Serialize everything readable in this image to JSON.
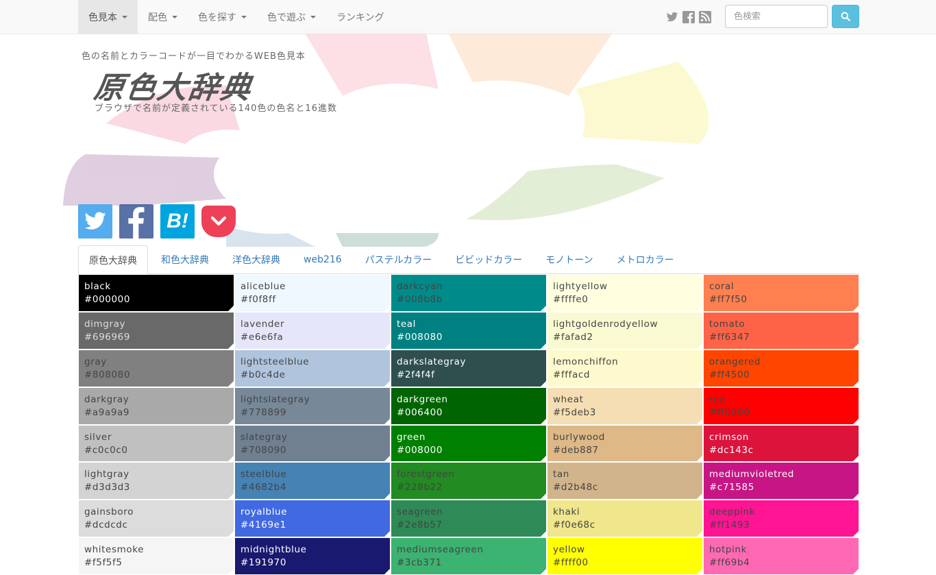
{
  "nav": {
    "items": [
      {
        "label": "色見本",
        "caret": true,
        "active": true
      },
      {
        "label": "配色",
        "caret": true
      },
      {
        "label": "色を探す",
        "caret": true
      },
      {
        "label": "色で遊ぶ",
        "caret": true
      },
      {
        "label": "ランキング",
        "caret": false
      }
    ],
    "social": [
      "twitter-icon",
      "facebook-icon",
      "rss-icon"
    ],
    "search_placeholder": "色検索"
  },
  "header": {
    "tagline": "色の名前とカラーコードが一目でわかるWEB色見本",
    "logo": "原色大辞典",
    "subtitle": "ブラウザで名前が定義されている140色の色名と16進数"
  },
  "share": [
    "twitter-share",
    "facebook-share",
    "hatena-bookmark-share",
    "pocket-share"
  ],
  "tabs": [
    {
      "label": "原色大辞典",
      "active": true
    },
    {
      "label": "和色大辞典"
    },
    {
      "label": "洋色大辞典"
    },
    {
      "label": "web216"
    },
    {
      "label": "パステルカラー"
    },
    {
      "label": "ビビッドカラー"
    },
    {
      "label": "モノトーン"
    },
    {
      "label": "メトロカラー"
    }
  ],
  "colors": [
    [
      {
        "name": "black",
        "hex": "#000000"
      },
      {
        "name": "dimgray",
        "hex": "#696969"
      },
      {
        "name": "gray",
        "hex": "#808080"
      },
      {
        "name": "darkgray",
        "hex": "#a9a9a9"
      },
      {
        "name": "silver",
        "hex": "#c0c0c0"
      },
      {
        "name": "lightgray",
        "hex": "#d3d3d3"
      },
      {
        "name": "gainsboro",
        "hex": "#dcdcdc"
      },
      {
        "name": "whitesmoke",
        "hex": "#f5f5f5"
      }
    ],
    [
      {
        "name": "aliceblue",
        "hex": "#f0f8ff"
      },
      {
        "name": "lavender",
        "hex": "#e6e6fa"
      },
      {
        "name": "lightsteelblue",
        "hex": "#b0c4de"
      },
      {
        "name": "lightslategray",
        "hex": "#778899"
      },
      {
        "name": "slategray",
        "hex": "#708090"
      },
      {
        "name": "steelblue",
        "hex": "#4682b4"
      },
      {
        "name": "royalblue",
        "hex": "#4169e1"
      },
      {
        "name": "midnightblue",
        "hex": "#191970"
      }
    ],
    [
      {
        "name": "darkcyan",
        "hex": "#008b8b"
      },
      {
        "name": "teal",
        "hex": "#008080"
      },
      {
        "name": "darkslategray",
        "hex": "#2f4f4f"
      },
      {
        "name": "darkgreen",
        "hex": "#006400"
      },
      {
        "name": "green",
        "hex": "#008000"
      },
      {
        "name": "forestgreen",
        "hex": "#228b22"
      },
      {
        "name": "seagreen",
        "hex": "#2e8b57"
      },
      {
        "name": "mediumseagreen",
        "hex": "#3cb371"
      }
    ],
    [
      {
        "name": "lightyellow",
        "hex": "#ffffe0"
      },
      {
        "name": "lightgoldenrodyellow",
        "hex": "#fafad2"
      },
      {
        "name": "lemonchiffon",
        "hex": "#fffacd"
      },
      {
        "name": "wheat",
        "hex": "#f5deb3"
      },
      {
        "name": "burlywood",
        "hex": "#deb887"
      },
      {
        "name": "tan",
        "hex": "#d2b48c"
      },
      {
        "name": "khaki",
        "hex": "#f0e68c"
      },
      {
        "name": "yellow",
        "hex": "#ffff00"
      }
    ],
    [
      {
        "name": "coral",
        "hex": "#ff7f50"
      },
      {
        "name": "tomato",
        "hex": "#ff6347"
      },
      {
        "name": "orangered",
        "hex": "#ff4500"
      },
      {
        "name": "red",
        "hex": "#ff0000"
      },
      {
        "name": "crimson",
        "hex": "#dc143c"
      },
      {
        "name": "mediumvioletred",
        "hex": "#c71585"
      },
      {
        "name": "deeppink",
        "hex": "#ff1493"
      },
      {
        "name": "hotpink",
        "hex": "#ff69b4"
      }
    ]
  ],
  "text_colors": [
    [
      "#ffffff",
      "#dddddd",
      "#444444",
      "#444444",
      "#444444",
      "#444444",
      "#444444",
      "#444444"
    ],
    [
      "#444444",
      "#444444",
      "#444444",
      "#444444",
      "#444444",
      "#444444",
      "#ffffff",
      "#ffffff"
    ],
    [
      "#444444",
      "#ffffff",
      "#ffffff",
      "#ffffff",
      "#ffffff",
      "#444444",
      "#444444",
      "#444444"
    ],
    [
      "#444444",
      "#444444",
      "#444444",
      "#444444",
      "#444444",
      "#444444",
      "#444444",
      "#444444"
    ],
    [
      "#444444",
      "#444444",
      "#444444",
      "#444444",
      "#ffffff",
      "#ffffff",
      "#444444",
      "#444444"
    ]
  ]
}
